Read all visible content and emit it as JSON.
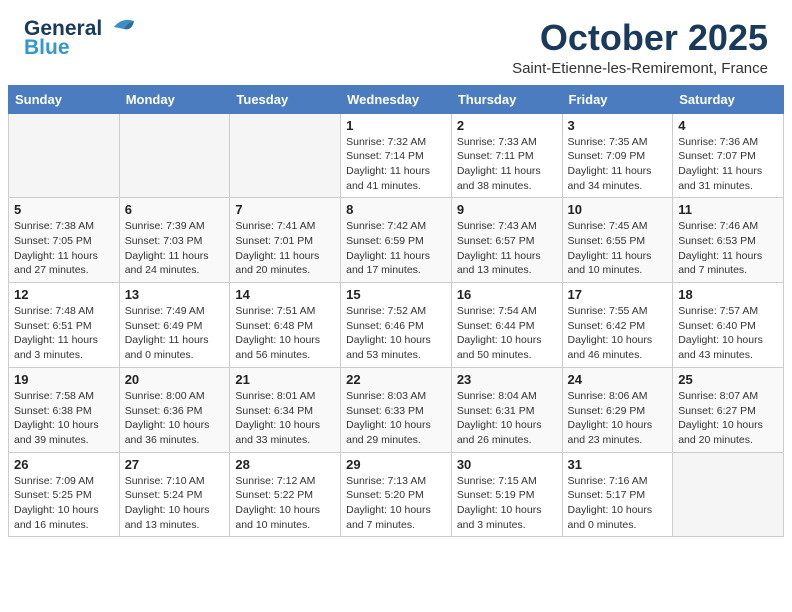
{
  "header": {
    "logo_line1": "General",
    "logo_line2": "Blue",
    "month": "October 2025",
    "location": "Saint-Etienne-les-Remiremont, France"
  },
  "weekdays": [
    "Sunday",
    "Monday",
    "Tuesday",
    "Wednesday",
    "Thursday",
    "Friday",
    "Saturday"
  ],
  "weeks": [
    [
      {
        "day": "",
        "sunrise": "",
        "sunset": "",
        "daylight": ""
      },
      {
        "day": "",
        "sunrise": "",
        "sunset": "",
        "daylight": ""
      },
      {
        "day": "",
        "sunrise": "",
        "sunset": "",
        "daylight": ""
      },
      {
        "day": "1",
        "sunrise": "Sunrise: 7:32 AM",
        "sunset": "Sunset: 7:14 PM",
        "daylight": "Daylight: 11 hours and 41 minutes."
      },
      {
        "day": "2",
        "sunrise": "Sunrise: 7:33 AM",
        "sunset": "Sunset: 7:11 PM",
        "daylight": "Daylight: 11 hours and 38 minutes."
      },
      {
        "day": "3",
        "sunrise": "Sunrise: 7:35 AM",
        "sunset": "Sunset: 7:09 PM",
        "daylight": "Daylight: 11 hours and 34 minutes."
      },
      {
        "day": "4",
        "sunrise": "Sunrise: 7:36 AM",
        "sunset": "Sunset: 7:07 PM",
        "daylight": "Daylight: 11 hours and 31 minutes."
      }
    ],
    [
      {
        "day": "5",
        "sunrise": "Sunrise: 7:38 AM",
        "sunset": "Sunset: 7:05 PM",
        "daylight": "Daylight: 11 hours and 27 minutes."
      },
      {
        "day": "6",
        "sunrise": "Sunrise: 7:39 AM",
        "sunset": "Sunset: 7:03 PM",
        "daylight": "Daylight: 11 hours and 24 minutes."
      },
      {
        "day": "7",
        "sunrise": "Sunrise: 7:41 AM",
        "sunset": "Sunset: 7:01 PM",
        "daylight": "Daylight: 11 hours and 20 minutes."
      },
      {
        "day": "8",
        "sunrise": "Sunrise: 7:42 AM",
        "sunset": "Sunset: 6:59 PM",
        "daylight": "Daylight: 11 hours and 17 minutes."
      },
      {
        "day": "9",
        "sunrise": "Sunrise: 7:43 AM",
        "sunset": "Sunset: 6:57 PM",
        "daylight": "Daylight: 11 hours and 13 minutes."
      },
      {
        "day": "10",
        "sunrise": "Sunrise: 7:45 AM",
        "sunset": "Sunset: 6:55 PM",
        "daylight": "Daylight: 11 hours and 10 minutes."
      },
      {
        "day": "11",
        "sunrise": "Sunrise: 7:46 AM",
        "sunset": "Sunset: 6:53 PM",
        "daylight": "Daylight: 11 hours and 7 minutes."
      }
    ],
    [
      {
        "day": "12",
        "sunrise": "Sunrise: 7:48 AM",
        "sunset": "Sunset: 6:51 PM",
        "daylight": "Daylight: 11 hours and 3 minutes."
      },
      {
        "day": "13",
        "sunrise": "Sunrise: 7:49 AM",
        "sunset": "Sunset: 6:49 PM",
        "daylight": "Daylight: 11 hours and 0 minutes."
      },
      {
        "day": "14",
        "sunrise": "Sunrise: 7:51 AM",
        "sunset": "Sunset: 6:48 PM",
        "daylight": "Daylight: 10 hours and 56 minutes."
      },
      {
        "day": "15",
        "sunrise": "Sunrise: 7:52 AM",
        "sunset": "Sunset: 6:46 PM",
        "daylight": "Daylight: 10 hours and 53 minutes."
      },
      {
        "day": "16",
        "sunrise": "Sunrise: 7:54 AM",
        "sunset": "Sunset: 6:44 PM",
        "daylight": "Daylight: 10 hours and 50 minutes."
      },
      {
        "day": "17",
        "sunrise": "Sunrise: 7:55 AM",
        "sunset": "Sunset: 6:42 PM",
        "daylight": "Daylight: 10 hours and 46 minutes."
      },
      {
        "day": "18",
        "sunrise": "Sunrise: 7:57 AM",
        "sunset": "Sunset: 6:40 PM",
        "daylight": "Daylight: 10 hours and 43 minutes."
      }
    ],
    [
      {
        "day": "19",
        "sunrise": "Sunrise: 7:58 AM",
        "sunset": "Sunset: 6:38 PM",
        "daylight": "Daylight: 10 hours and 39 minutes."
      },
      {
        "day": "20",
        "sunrise": "Sunrise: 8:00 AM",
        "sunset": "Sunset: 6:36 PM",
        "daylight": "Daylight: 10 hours and 36 minutes."
      },
      {
        "day": "21",
        "sunrise": "Sunrise: 8:01 AM",
        "sunset": "Sunset: 6:34 PM",
        "daylight": "Daylight: 10 hours and 33 minutes."
      },
      {
        "day": "22",
        "sunrise": "Sunrise: 8:03 AM",
        "sunset": "Sunset: 6:33 PM",
        "daylight": "Daylight: 10 hours and 29 minutes."
      },
      {
        "day": "23",
        "sunrise": "Sunrise: 8:04 AM",
        "sunset": "Sunset: 6:31 PM",
        "daylight": "Daylight: 10 hours and 26 minutes."
      },
      {
        "day": "24",
        "sunrise": "Sunrise: 8:06 AM",
        "sunset": "Sunset: 6:29 PM",
        "daylight": "Daylight: 10 hours and 23 minutes."
      },
      {
        "day": "25",
        "sunrise": "Sunrise: 8:07 AM",
        "sunset": "Sunset: 6:27 PM",
        "daylight": "Daylight: 10 hours and 20 minutes."
      }
    ],
    [
      {
        "day": "26",
        "sunrise": "Sunrise: 7:09 AM",
        "sunset": "Sunset: 5:25 PM",
        "daylight": "Daylight: 10 hours and 16 minutes."
      },
      {
        "day": "27",
        "sunrise": "Sunrise: 7:10 AM",
        "sunset": "Sunset: 5:24 PM",
        "daylight": "Daylight: 10 hours and 13 minutes."
      },
      {
        "day": "28",
        "sunrise": "Sunrise: 7:12 AM",
        "sunset": "Sunset: 5:22 PM",
        "daylight": "Daylight: 10 hours and 10 minutes."
      },
      {
        "day": "29",
        "sunrise": "Sunrise: 7:13 AM",
        "sunset": "Sunset: 5:20 PM",
        "daylight": "Daylight: 10 hours and 7 minutes."
      },
      {
        "day": "30",
        "sunrise": "Sunrise: 7:15 AM",
        "sunset": "Sunset: 5:19 PM",
        "daylight": "Daylight: 10 hours and 3 minutes."
      },
      {
        "day": "31",
        "sunrise": "Sunrise: 7:16 AM",
        "sunset": "Sunset: 5:17 PM",
        "daylight": "Daylight: 10 hours and 0 minutes."
      },
      {
        "day": "",
        "sunrise": "",
        "sunset": "",
        "daylight": ""
      }
    ]
  ]
}
